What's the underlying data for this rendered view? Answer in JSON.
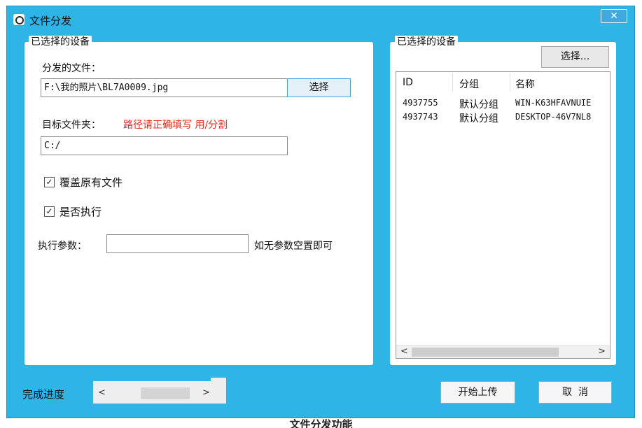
{
  "window": {
    "title": "文件分发",
    "close_label": "✕"
  },
  "left_panel": {
    "legend": "已选择的设备",
    "file_label": "分发的文件：",
    "file_value": "F:\\我的照片\\BL7A0009.jpg",
    "file_button": "选择",
    "target_label": "目标文件夹：",
    "target_hint": "路径请正确填写 用/分割",
    "target_value": "C:/",
    "overwrite": {
      "label": "覆盖原有文件",
      "checked": true
    },
    "execute": {
      "label": "是否执行",
      "checked": true
    },
    "params_label": "执行参数：",
    "params_value": "",
    "params_hint": "如无参数空置即可"
  },
  "right_panel": {
    "legend": "已选择的设备",
    "select_button": "选择...",
    "columns": [
      "ID",
      "分组",
      "名称"
    ],
    "rows": [
      {
        "id": "4937755",
        "group": "默认分组",
        "name": "WIN-K63HFAVNUIE"
      },
      {
        "id": "4937743",
        "group": "默认分组",
        "name": "DESKTOP-46V7NL8"
      }
    ]
  },
  "footer": {
    "progress_label": "完成进度",
    "start_button": "开始上传",
    "cancel_button": "取  消"
  },
  "caption": "文件分发功能",
  "colors": {
    "window_bg": "#2fb4e6",
    "hint_red": "#f0281f"
  }
}
